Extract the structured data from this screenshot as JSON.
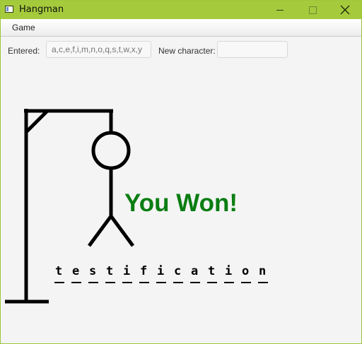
{
  "window": {
    "title": "Hangman"
  },
  "menu": {
    "game": "Game"
  },
  "controls": {
    "entered_label": "Entered:",
    "entered_placeholder": "a,c,e,f,i,m,n,o,q,s,t,w,x,y",
    "new_char_label": "New character:",
    "new_char_value": ""
  },
  "game": {
    "status": "You Won!",
    "word": [
      "t",
      "e",
      "s",
      "t",
      "i",
      "f",
      "i",
      "c",
      "a",
      "t",
      "i",
      "o",
      "n"
    ],
    "status_color": "#0a7d12"
  },
  "colors": {
    "titlebar": "#a5cb3c",
    "background": "#f4f4f4"
  }
}
